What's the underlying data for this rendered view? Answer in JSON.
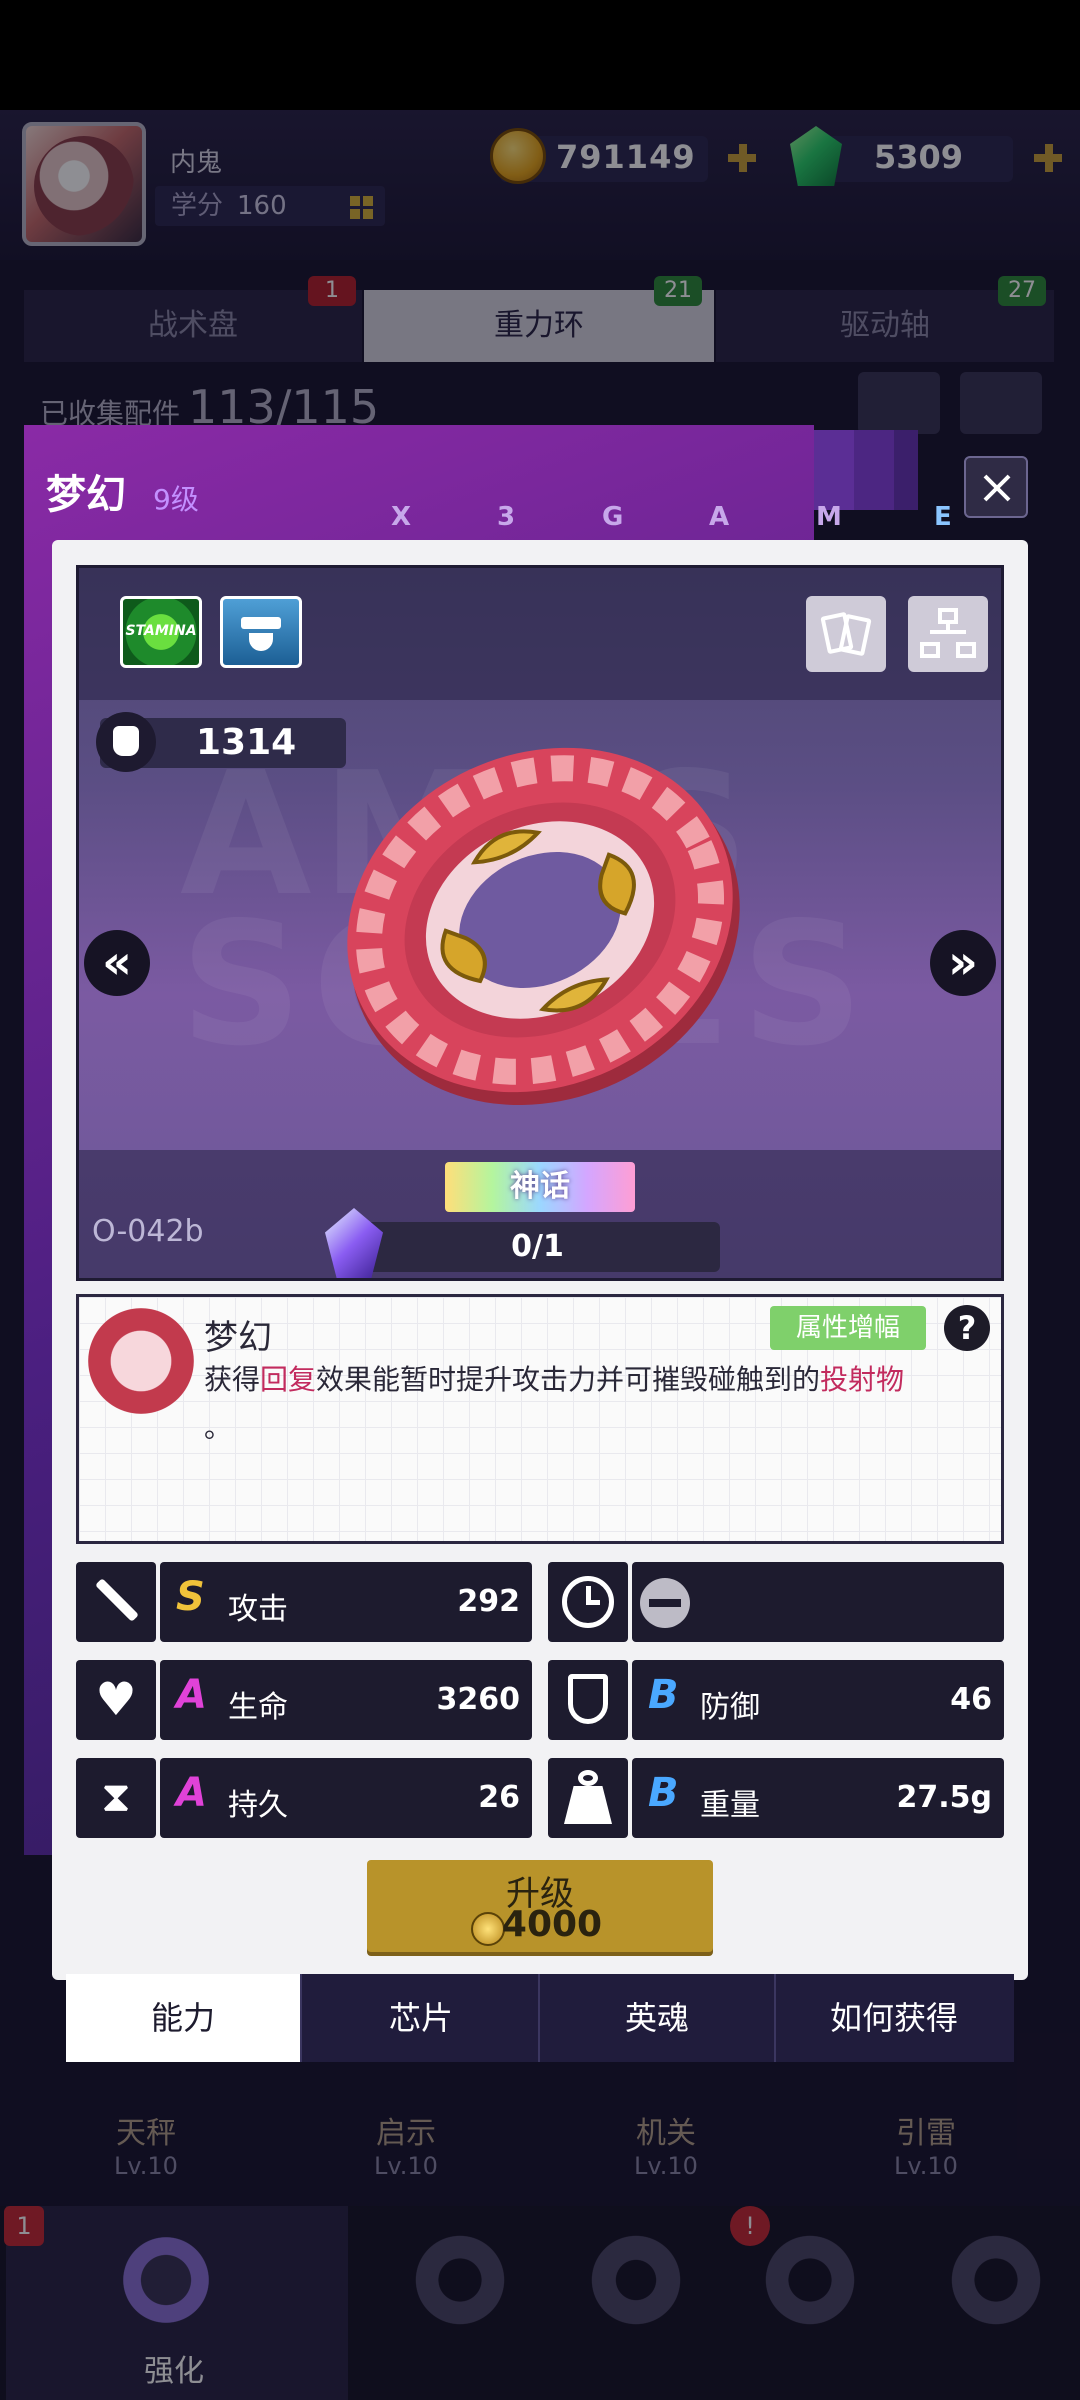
{
  "header": {
    "username": "内鬼",
    "credit_label": "学分",
    "credit_value": "160",
    "coins": "791149",
    "gems": "5309"
  },
  "tabs": [
    {
      "label": "战术盘",
      "badge": "1"
    },
    {
      "label": "重力环",
      "badge": "21"
    },
    {
      "label": "驱动轴",
      "badge": "27"
    }
  ],
  "collection": {
    "label": "已收集配件",
    "value": "113/115"
  },
  "panel": {
    "title": "梦幻",
    "level": "9级",
    "letters": [
      "X",
      "3",
      "G",
      "A",
      "M",
      "E"
    ]
  },
  "showcase": {
    "type_badge": "STAMINA",
    "power": "1314",
    "watermark": "AMES SOUES",
    "rarity": "神话",
    "item_code": "O-042b",
    "progress": "0/1"
  },
  "description": {
    "title": "梦幻",
    "tag": "属性增幅",
    "help": "?",
    "text_before": "获得",
    "highlight_1": "回复",
    "text_middle": "效果能暂时提升攻击力并可摧毁碰触到的",
    "highlight_2": "投射物",
    "text_end": "。"
  },
  "stats": {
    "attack": {
      "grade": "S",
      "name": "攻击",
      "value": "292"
    },
    "hp": {
      "grade": "A",
      "name": "生命",
      "value": "3260"
    },
    "durability": {
      "grade": "A",
      "name": "持久",
      "value": "26"
    },
    "defense": {
      "grade": "B",
      "name": "防御",
      "value": "46"
    },
    "weight": {
      "grade": "B",
      "name": "重量",
      "value": "27.5g"
    }
  },
  "upgrade": {
    "label": "升级",
    "cost": "4000"
  },
  "bottom_tabs": [
    "能力",
    "芯片",
    "英魂",
    "如何获得"
  ],
  "hero_row": [
    {
      "name": "天秤",
      "level": "Lv.10"
    },
    {
      "name": "启示",
      "level": "Lv.10"
    },
    {
      "name": "机关",
      "level": "Lv.10"
    },
    {
      "name": "引雷",
      "level": "Lv.10"
    }
  ],
  "nav": {
    "active_label": "强化",
    "badge": "1",
    "alert": "!"
  },
  "colors": {
    "grade_S": "#f0c23a",
    "grade_A": "#e042d8",
    "grade_B": "#4aa8ff",
    "upgrade": "#b8932a"
  }
}
